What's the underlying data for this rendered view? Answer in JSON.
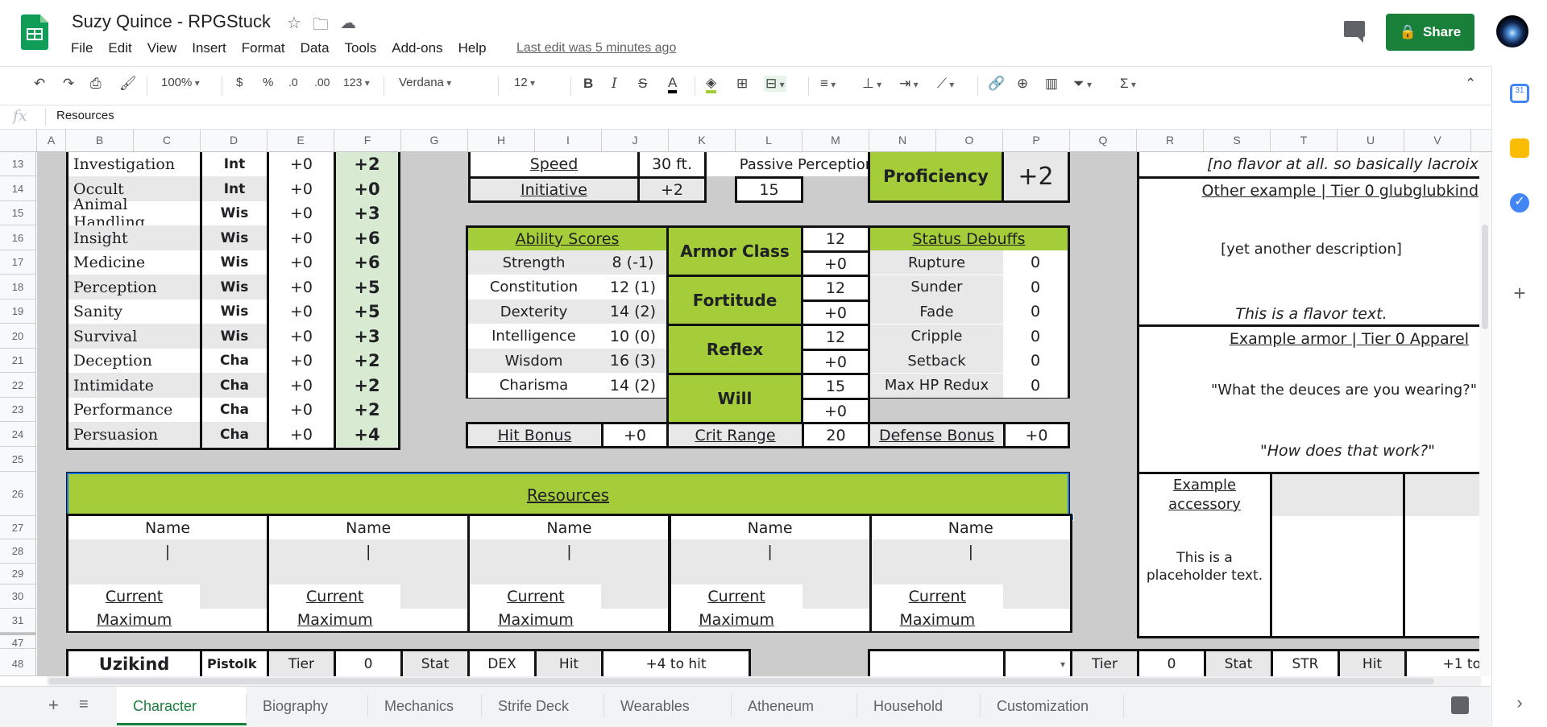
{
  "app": {
    "title": "Suzy Quince - RPGStuck",
    "last_edit": "Last edit was 5 minutes ago",
    "share_label": "Share"
  },
  "menu": [
    "File",
    "Edit",
    "View",
    "Insert",
    "Format",
    "Data",
    "Tools",
    "Add-ons",
    "Help"
  ],
  "toolbar": {
    "zoom": "100%",
    "currency": "$",
    "percent": "%",
    "dec_less": ".0",
    "dec_more": ".00",
    "more_formats": "123",
    "font": "Verdana",
    "font_size": "12"
  },
  "formula": {
    "fx": "fx",
    "value": "Resources"
  },
  "columns": [
    "A",
    "B",
    "C",
    "D",
    "E",
    "F",
    "G",
    "H",
    "I",
    "J",
    "K",
    "L",
    "M",
    "N",
    "O",
    "P",
    "Q",
    "R",
    "S",
    "T",
    "U",
    "V"
  ],
  "rows": [
    "13",
    "14",
    "15",
    "16",
    "17",
    "18",
    "19",
    "20",
    "21",
    "22",
    "23",
    "24",
    "25",
    "26",
    "27",
    "28",
    "29",
    "30",
    "31",
    "47",
    "48"
  ],
  "skills": [
    {
      "name": "Investigation",
      "stat": "Int",
      "mod": "+0",
      "total": "+2"
    },
    {
      "name": "Occult",
      "stat": "Int",
      "mod": "+0",
      "total": "+0"
    },
    {
      "name": "Animal Handling",
      "stat": "Wis",
      "mod": "+0",
      "total": "+3"
    },
    {
      "name": "Insight",
      "stat": "Wis",
      "mod": "+0",
      "total": "+6"
    },
    {
      "name": "Medicine",
      "stat": "Wis",
      "mod": "+0",
      "total": "+6"
    },
    {
      "name": "Perception",
      "stat": "Wis",
      "mod": "+0",
      "total": "+5"
    },
    {
      "name": "Sanity",
      "stat": "Wis",
      "mod": "+0",
      "total": "+5"
    },
    {
      "name": "Survival",
      "stat": "Wis",
      "mod": "+0",
      "total": "+3"
    },
    {
      "name": "Deception",
      "stat": "Cha",
      "mod": "+0",
      "total": "+2"
    },
    {
      "name": "Intimidate",
      "stat": "Cha",
      "mod": "+0",
      "total": "+2"
    },
    {
      "name": "Performance",
      "stat": "Cha",
      "mod": "+0",
      "total": "+2"
    },
    {
      "name": "Persuasion",
      "stat": "Cha",
      "mod": "+0",
      "total": "+4"
    }
  ],
  "speed": {
    "label": "Speed",
    "value": "30 ft."
  },
  "initiative": {
    "label": "Initiative",
    "value": "+2"
  },
  "passive": {
    "label": "Passive Perception",
    "value": "15"
  },
  "proficiency": {
    "label": "Proficiency",
    "value": "+2"
  },
  "ability": {
    "title": "Ability Scores",
    "items": [
      {
        "name": "Strength",
        "value": "8 (-1)"
      },
      {
        "name": "Constitution",
        "value": "12 (1)"
      },
      {
        "name": "Dexterity",
        "value": "14 (2)"
      },
      {
        "name": "Intelligence",
        "value": "10 (0)"
      },
      {
        "name": "Wisdom",
        "value": "16 (3)"
      },
      {
        "name": "Charisma",
        "value": "14 (2)"
      }
    ]
  },
  "defenses": [
    {
      "name": "Armor Class",
      "value": "12",
      "bonus": "+0"
    },
    {
      "name": "Fortitude",
      "value": "12",
      "bonus": "+0"
    },
    {
      "name": "Reflex",
      "value": "12",
      "bonus": "+0"
    },
    {
      "name": "Will",
      "value": "15",
      "bonus": "+0"
    }
  ],
  "debuffs": {
    "title": "Status Debuffs",
    "items": [
      {
        "name": "Rupture",
        "value": "0"
      },
      {
        "name": "Sunder",
        "value": "0"
      },
      {
        "name": "Fade",
        "value": "0"
      },
      {
        "name": "Cripple",
        "value": "0"
      },
      {
        "name": "Setback",
        "value": "0"
      },
      {
        "name": "Max HP Redux",
        "value": "0"
      }
    ]
  },
  "bonuses": {
    "hit_label": "Hit Bonus",
    "hit_value": "+0",
    "crit_label": "Crit Range",
    "crit_value": "20",
    "def_label": "Defense Bonus",
    "def_value": "+0"
  },
  "right_panel": {
    "flavor1": "[no flavor at all. so basically lacroix",
    "other_example": "Other example | Tier 0 glubglubkind",
    "desc": "[yet another description]",
    "flavor2": "This is a flavor text.",
    "armor": "Example armor | Tier 0 Apparel",
    "armor_quote": "\"What the deuces are you wearing?\"",
    "armor_flavor": "\"How does that work?\"",
    "accessory": "Example accessory",
    "accessory_text": "This is a placeholder text."
  },
  "resources": {
    "title": "Resources",
    "name_label": "Name",
    "cursor": "|",
    "current_label": "Current",
    "maximum_label": "Maximum"
  },
  "row48": {
    "weapon": "Uzikind",
    "weapon2": "Pistolk",
    "tier_label": "Tier",
    "tier": "0",
    "stat_label": "Stat",
    "stat": "DEX",
    "hit_label": "Hit",
    "hit": "+4 to hit",
    "tier2": "0",
    "stat2": "STR",
    "hit2": "+1 to"
  },
  "sheet_tabs": [
    "Character",
    "Biography",
    "Mechanics",
    "Strife Deck",
    "Wearables",
    "Atheneum",
    "Household",
    "Customization"
  ]
}
